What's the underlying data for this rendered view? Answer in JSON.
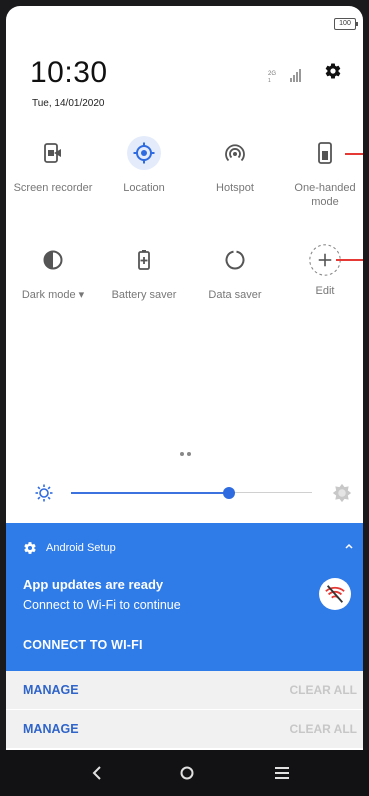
{
  "status_bar": {
    "battery": "100"
  },
  "header": {
    "time": "10:30",
    "date": "Tue, 14/01/2020"
  },
  "quick_tiles": [
    {
      "label": "Screen recorder",
      "icon": "screen-recorder-icon",
      "active": false
    },
    {
      "label": "Location",
      "icon": "location-icon",
      "active": true
    },
    {
      "label": "Hotspot",
      "icon": "hotspot-icon",
      "active": false
    },
    {
      "label": "One-handed mode",
      "icon": "one-handed-mode-icon",
      "active": false
    },
    {
      "label": "Dark mode ▾",
      "icon": "dark-mode-icon",
      "active": false
    },
    {
      "label": "Battery saver",
      "icon": "battery-saver-icon",
      "active": false
    },
    {
      "label": "Data saver",
      "icon": "data-saver-icon",
      "active": false
    },
    {
      "label": "Edit",
      "icon": "add-icon",
      "active": false
    }
  ],
  "brightness": {
    "level": 0.66
  },
  "notification": {
    "app": "Android Setup",
    "title": "App updates are ready",
    "text": "Connect to Wi-Fi to continue",
    "action": "CONNECT TO WI-FI",
    "colors": {
      "background": "#2f7be8"
    }
  },
  "manage_rows": [
    {
      "manage": "MANAGE",
      "clear": "CLEAR ALL"
    },
    {
      "manage": "MANAGE",
      "clear": "CLEAR ALL"
    }
  ],
  "colors": {
    "accent": "#2f6be0",
    "annotation": "#e53935"
  }
}
